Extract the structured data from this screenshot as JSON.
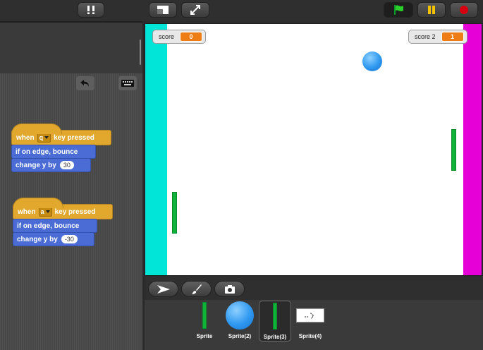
{
  "scripts": [
    {
      "hat": {
        "when": "when",
        "key": "q",
        "rest": "key pressed"
      },
      "blocks": [
        {
          "text": "if on edge, bounce"
        },
        {
          "text": "change y by",
          "value": "30"
        }
      ]
    },
    {
      "hat": {
        "when": "when",
        "key": "a",
        "rest": "key pressed"
      },
      "blocks": [
        {
          "text": "if on edge, bounce"
        },
        {
          "text": "change y by",
          "value": "-30"
        }
      ]
    }
  ],
  "stage": {
    "monitors": [
      {
        "label": "score",
        "value": "0"
      },
      {
        "label": "score 2",
        "value": "1"
      }
    ],
    "colors": {
      "left_wall": "#00e5d8",
      "right_wall": "#e600d7",
      "paddle": "#0fb33a",
      "monitor_value": "#ee7d16"
    }
  },
  "sprites": [
    {
      "name": "Sprite",
      "icon": "paddle-thumbnail",
      "selected": false
    },
    {
      "name": "Sprite(2)",
      "icon": "ball-thumbnail",
      "selected": false
    },
    {
      "name": "Sprite(3)",
      "icon": "paddle-thumbnail",
      "selected": true
    },
    {
      "name": "Sprite(4)",
      "icon": "drawing-thumbnail",
      "selected": false
    }
  ],
  "icons": {
    "tips": "exclamation-icon",
    "small_stage": "small-stage-icon",
    "fullscreen": "fullscreen-icon",
    "green_flag": "green-flag-icon",
    "pause": "pause-icon",
    "stop": "stop-icon",
    "undo": "undo-icon",
    "keyboard": "keyboard-icon",
    "select_tool": "arrow-pointer-icon",
    "paint_tool": "paintbrush-icon",
    "camera_tool": "camera-icon"
  }
}
